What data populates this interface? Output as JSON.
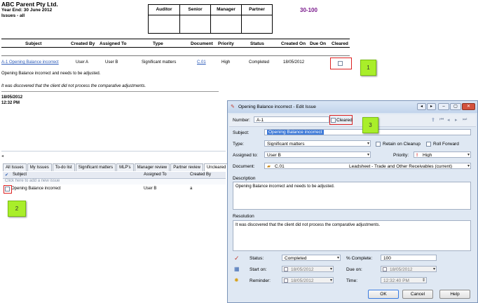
{
  "report": {
    "company": "ABC Parent Pty Ltd.",
    "year_end": "Year End: 30 June 2012",
    "issues": "Issues - all",
    "signoff_headers": [
      "Auditor",
      "Senior",
      "Manager",
      "Partner"
    ],
    "ref": "30-100",
    "columns": [
      "Subject",
      "Created By",
      "Assigned To",
      "Type",
      "Document",
      "Priority",
      "Status",
      "Created On",
      "Due On",
      "Cleared"
    ],
    "row": {
      "subject": "A-1   Opening Balance incorrect",
      "created_by": "User A",
      "assigned_to": "User B",
      "type": "Significant matters",
      "document": "C.01",
      "priority": "High",
      "status": "Completed",
      "created_on": "18/05/2012"
    },
    "description": "Opening Balance incorrect and needs to be adjusted.",
    "resolution": "It was discovered that the client did not process the comparative adjustments.",
    "date": "18/05/2012",
    "time": "12:32 PM"
  },
  "pane": {
    "tabs": [
      "All Issues",
      "My Issues",
      "To-do list",
      "Significant matters",
      "MLP's",
      "Manager review",
      "Partner review",
      "Uncleared Iss"
    ],
    "grid_headers": [
      "Subject",
      "Assigned To",
      "Created By"
    ],
    "add_new": "Click here to add a new issue",
    "row": {
      "subject": "Opening Balance incorrect",
      "assigned_to": "User B",
      "created_by": "a"
    }
  },
  "callouts": [
    "1",
    "2",
    "3"
  ],
  "dialog": {
    "title": "Opening Balance incorrect - Edit Issue",
    "number_label": "Number:",
    "number_value": "A-1",
    "cleared_label": "Cleared",
    "subject_label": "Subject:",
    "subject_value": "Opening Balance incorrect",
    "type_label": "Type:",
    "type_value": "Significant matters",
    "retain_label": "Retain on Cleanup",
    "roll_label": "Roll Forward",
    "assigned_label": "Assigned to:",
    "assigned_value": "User B",
    "priority_label": "Priority:",
    "priority_value": "High",
    "document_label": "Document:",
    "document_ref": "C.01",
    "document_name": "Leadsheet - Trade and Other Receivables (current)",
    "description_label": "Description",
    "description_text": "Opening Balance incorrect and needs to be adjusted.",
    "resolution_label": "Resolution",
    "resolution_text": "It was discovered that the client did not process the comparative adjustments.",
    "status_label": "Status:",
    "status_value": "Completed",
    "complete_label": "% Complete:",
    "complete_value": "100",
    "start_label": "Start on:",
    "start_value": "18/05/2012",
    "due_label": "Due on:",
    "due_value": "18/05/2012",
    "reminder_label": "Reminder:",
    "reminder_value": "18/05/2012",
    "time_label": "Time:",
    "time_value": "12:32:40 PM",
    "ok": "OK",
    "cancel": "Cancel",
    "help": "Help"
  }
}
